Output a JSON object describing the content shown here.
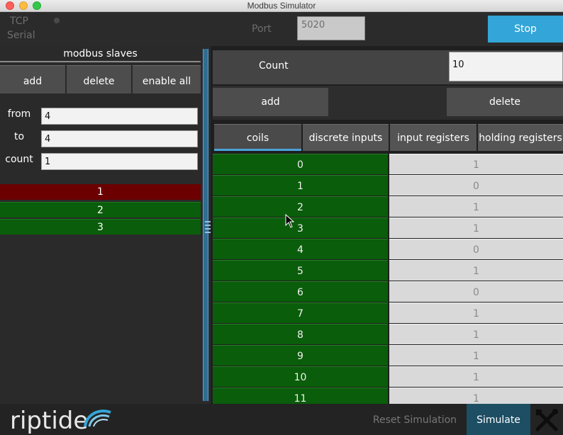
{
  "window": {
    "title": "Modbus Simulator"
  },
  "connection": {
    "tcp_label": "TCP",
    "serial_label": "Serial",
    "port_label": "Port",
    "port_value": "5020",
    "stop_label": "Stop"
  },
  "slaves": {
    "header": "modbus slaves",
    "add_label": "add",
    "delete_label": "delete",
    "enable_all_label": "enable all",
    "from_label": "from",
    "from_value": "4",
    "to_label": "to",
    "to_value": "4",
    "count_label": "count",
    "count_value": "1",
    "items": [
      {
        "label": "1",
        "state": "disabled"
      },
      {
        "label": "2",
        "state": "enabled"
      },
      {
        "label": "3",
        "state": "enabled"
      }
    ]
  },
  "registers": {
    "count_label": "Count",
    "count_value": "10",
    "add_label": "add",
    "delete_label": "delete",
    "tabs": [
      "coils",
      "discrete inputs",
      "input registers",
      "holding registers"
    ],
    "active_tab": "coils",
    "rows": [
      {
        "address": "0",
        "value": "1"
      },
      {
        "address": "1",
        "value": "0"
      },
      {
        "address": "2",
        "value": "1"
      },
      {
        "address": "3",
        "value": "1"
      },
      {
        "address": "4",
        "value": "0"
      },
      {
        "address": "5",
        "value": "1"
      },
      {
        "address": "6",
        "value": "0"
      },
      {
        "address": "7",
        "value": "1"
      },
      {
        "address": "8",
        "value": "1"
      },
      {
        "address": "9",
        "value": "1"
      },
      {
        "address": "10",
        "value": "1"
      },
      {
        "address": "11",
        "value": "1"
      }
    ]
  },
  "footer": {
    "logo_text": "riptide",
    "reset_label": "Reset Simulation",
    "simulate_label": "Simulate"
  },
  "colors": {
    "accent": "#33a5d8",
    "enabled": "#0a5d0a",
    "disabled": "#6c0000",
    "simulate": "#1d4e63"
  }
}
